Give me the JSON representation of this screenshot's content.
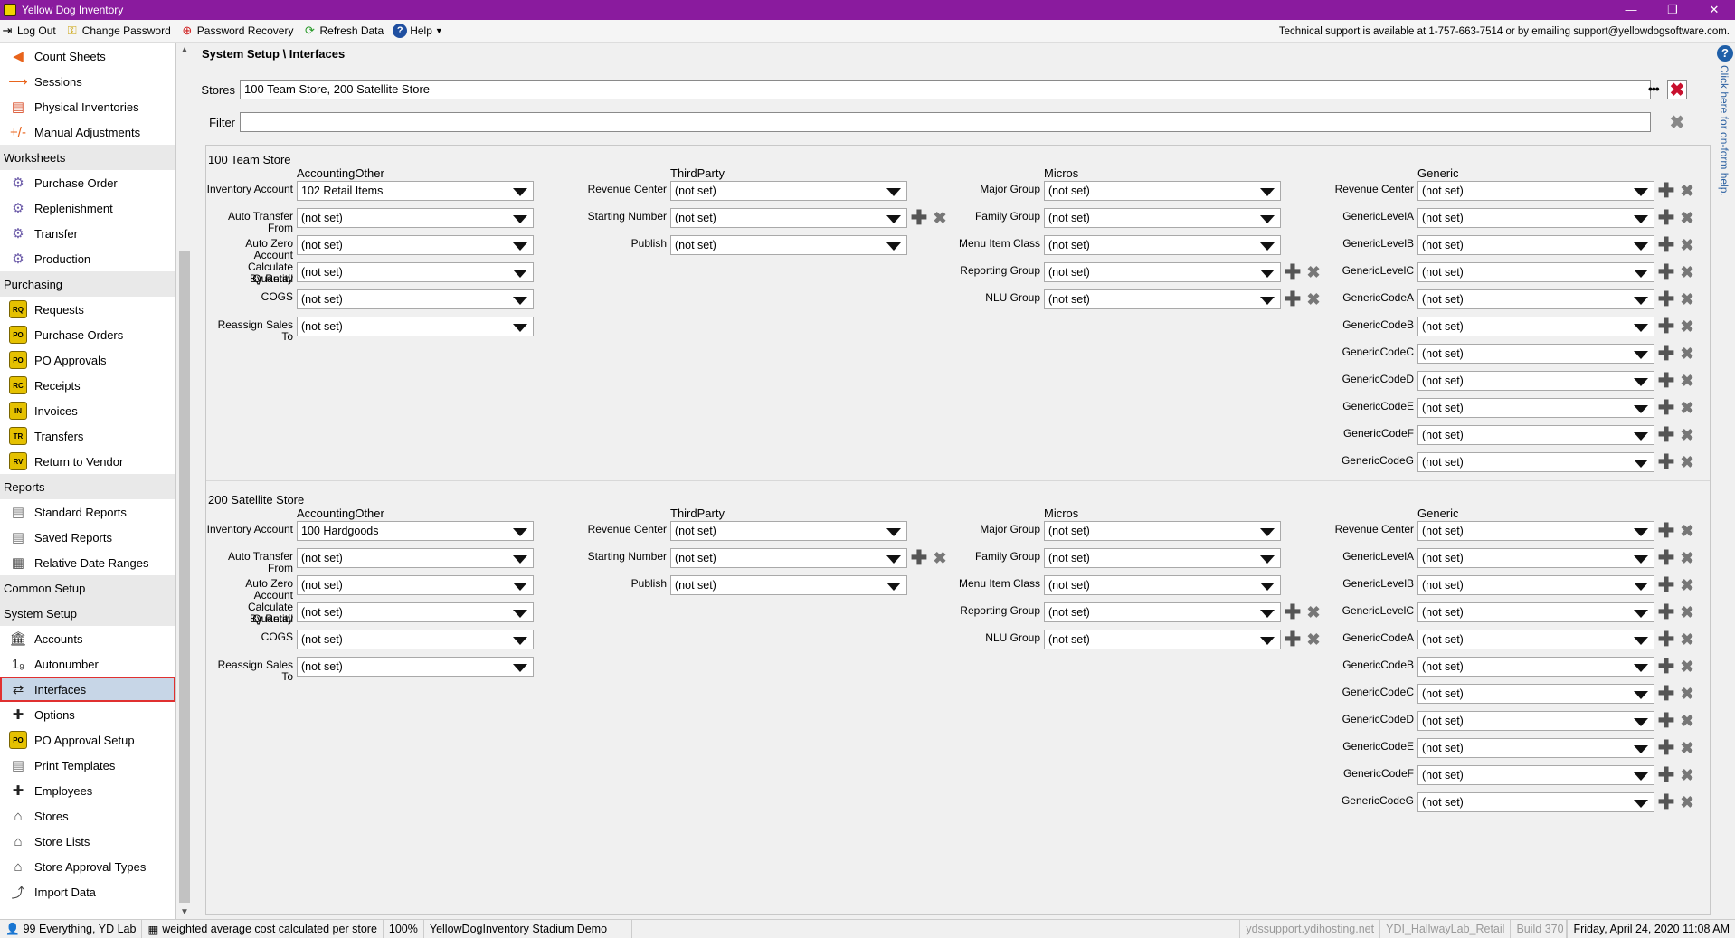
{
  "window": {
    "title": "Yellow Dog Inventory",
    "minimize": "—",
    "restore": "❐",
    "close": "✕"
  },
  "toolbar": {
    "logout": "Log Out",
    "change_password": "Change Password",
    "password_recovery": "Password Recovery",
    "refresh": "Refresh Data",
    "help": "Help"
  },
  "support_text": "Technical support is available at 1-757-663-7514 or by emailing support@yellowdogsoftware.com.",
  "sidebar": {
    "items": [
      {
        "label": "Count Sheets",
        "type": "item",
        "icon": "count-sheets-icon",
        "glyph": "◀",
        "color": "#e8641c"
      },
      {
        "label": "Sessions",
        "type": "item",
        "icon": "sessions-icon",
        "glyph": "⟶",
        "color": "#e8641c"
      },
      {
        "label": "Physical Inventories",
        "type": "item",
        "icon": "physical-inventories-icon",
        "glyph": "▤",
        "color": "#d9502c"
      },
      {
        "label": "Manual Adjustments",
        "type": "item",
        "icon": "manual-adjustments-icon",
        "glyph": "+/-",
        "color": "#e8641c"
      },
      {
        "label": "Worksheets",
        "type": "header"
      },
      {
        "label": "Purchase Order",
        "type": "item",
        "icon": "purchase-order-worksheet-icon",
        "glyph": "⚙",
        "color": "#6b5aa8"
      },
      {
        "label": "Replenishment",
        "type": "item",
        "icon": "replenishment-icon",
        "glyph": "⚙",
        "color": "#6b5aa8"
      },
      {
        "label": "Transfer",
        "type": "item",
        "icon": "transfer-worksheet-icon",
        "glyph": "⚙",
        "color": "#6b5aa8"
      },
      {
        "label": "Production",
        "type": "item",
        "icon": "production-icon",
        "glyph": "⚙",
        "color": "#6b5aa8"
      },
      {
        "label": "Purchasing",
        "type": "header"
      },
      {
        "label": "Requests",
        "type": "item",
        "icon": "requests-icon",
        "glyph": "RQ",
        "color": "#e5c100"
      },
      {
        "label": "Purchase Orders",
        "type": "item",
        "icon": "purchase-orders-icon",
        "glyph": "PO",
        "color": "#e5c100"
      },
      {
        "label": "PO Approvals",
        "type": "item",
        "icon": "po-approvals-icon",
        "glyph": "PO",
        "color": "#e5c100"
      },
      {
        "label": "Receipts",
        "type": "item",
        "icon": "receipts-icon",
        "glyph": "RC",
        "color": "#e5c100"
      },
      {
        "label": "Invoices",
        "type": "item",
        "icon": "invoices-icon",
        "glyph": "IN",
        "color": "#e5c100"
      },
      {
        "label": "Transfers",
        "type": "item",
        "icon": "transfers-icon",
        "glyph": "TR",
        "color": "#e5c100"
      },
      {
        "label": "Return to Vendor",
        "type": "item",
        "icon": "return-to-vendor-icon",
        "glyph": "RV",
        "color": "#e5c100"
      },
      {
        "label": "Reports",
        "type": "header"
      },
      {
        "label": "Standard Reports",
        "type": "item",
        "icon": "standard-reports-icon",
        "glyph": "▤",
        "color": "#777"
      },
      {
        "label": "Saved Reports",
        "type": "item",
        "icon": "saved-reports-icon",
        "glyph": "▤",
        "color": "#777"
      },
      {
        "label": "Relative Date Ranges",
        "type": "item",
        "icon": "calendar-icon",
        "glyph": "▦",
        "color": "#555"
      },
      {
        "label": "Common Setup",
        "type": "header"
      },
      {
        "label": "System Setup",
        "type": "header"
      },
      {
        "label": "Accounts",
        "type": "item",
        "icon": "bank-icon",
        "glyph": "🏛",
        "color": "#333"
      },
      {
        "label": "Autonumber",
        "type": "item",
        "icon": "autonumber-icon",
        "glyph": "1₉",
        "color": "#333"
      },
      {
        "label": "Interfaces",
        "type": "item",
        "icon": "interfaces-icon",
        "glyph": "⇄",
        "color": "#222",
        "selected": true
      },
      {
        "label": "Options",
        "type": "item",
        "icon": "options-plus-icon",
        "glyph": "✚",
        "color": "#222"
      },
      {
        "label": "PO Approval Setup",
        "type": "item",
        "icon": "po-approval-setup-icon",
        "glyph": "PO",
        "color": "#e5c100"
      },
      {
        "label": "Print Templates",
        "type": "item",
        "icon": "print-templates-icon",
        "glyph": "▤",
        "color": "#777"
      },
      {
        "label": "Employees",
        "type": "item",
        "icon": "employees-plus-icon",
        "glyph": "✚",
        "color": "#222"
      },
      {
        "label": "Stores",
        "type": "item",
        "icon": "stores-icon",
        "glyph": "⌂",
        "color": "#444"
      },
      {
        "label": "Store Lists",
        "type": "item",
        "icon": "store-lists-icon",
        "glyph": "⌂",
        "color": "#444"
      },
      {
        "label": "Store Approval Types",
        "type": "item",
        "icon": "store-approval-types-icon",
        "glyph": "⌂",
        "color": "#444"
      },
      {
        "label": "Import Data",
        "type": "item",
        "icon": "import-data-icon",
        "glyph": "⤴",
        "color": "#444"
      }
    ]
  },
  "breadcrumb": "System Setup \\ Interfaces",
  "stores_filter": {
    "label": "Stores",
    "value": "100 Team Store, 200 Satellite Store",
    "ellipsis": "•••"
  },
  "filter": {
    "label": "Filter",
    "value": ""
  },
  "sections": [
    {
      "title": "100 Team Store",
      "accounting": {
        "header": "AccountingOther",
        "fields": [
          {
            "label": "Inventory Account",
            "value": "102 Retail Items"
          },
          {
            "label": "Auto Transfer From",
            "value": "(not set)"
          },
          {
            "label": "Auto Zero Account",
            "value": "(not set)"
          },
          {
            "label": "Calculate Quantity By Retail COGS",
            "label1": "Calculate Quantity",
            "label2": "By Retail",
            "label3": "COGS",
            "value": "(not set)",
            "value2": "(not set)"
          },
          {
            "label": "Reassign Sales To",
            "value": "(not set)"
          }
        ]
      },
      "thirdparty": {
        "header": "ThirdParty",
        "fields": [
          {
            "label": "Revenue Center",
            "value": "(not set)"
          },
          {
            "label": "Starting Number",
            "value": "(not set)"
          },
          {
            "label": "Publish",
            "value": "(not set)"
          }
        ]
      },
      "micros": {
        "header": "Micros",
        "fields": [
          {
            "label": "Major Group",
            "value": "(not set)"
          },
          {
            "label": "Family Group",
            "value": "(not set)"
          },
          {
            "label": "Menu Item Class",
            "value": "(not set)"
          },
          {
            "label": "Reporting Group",
            "value": "(not set)"
          },
          {
            "label": "NLU Group",
            "value": "(not set)"
          }
        ]
      },
      "generic": {
        "header": "Generic",
        "fields": [
          {
            "label": "Revenue Center",
            "value": "(not set)"
          },
          {
            "label": "GenericLevelA",
            "value": "(not set)"
          },
          {
            "label": "GenericLevelB",
            "value": "(not set)"
          },
          {
            "label": "GenericLevelC",
            "value": "(not set)"
          },
          {
            "label": "GenericCodeA",
            "value": "(not set)"
          },
          {
            "label": "GenericCodeB",
            "value": "(not set)"
          },
          {
            "label": "GenericCodeC",
            "value": "(not set)"
          },
          {
            "label": "GenericCodeD",
            "value": "(not set)"
          },
          {
            "label": "GenericCodeE",
            "value": "(not set)"
          },
          {
            "label": "GenericCodeF",
            "value": "(not set)"
          },
          {
            "label": "GenericCodeG",
            "value": "(not set)"
          }
        ]
      }
    },
    {
      "title": "200 Satellite Store",
      "accounting": {
        "header": "AccountingOther",
        "fields": [
          {
            "label": "Inventory Account",
            "value": "100 Hardgoods"
          },
          {
            "label": "Auto Transfer From",
            "value": "(not set)"
          },
          {
            "label": "Auto Zero Account",
            "value": "(not set)"
          },
          {
            "label": "Calculate Quantity By Retail COGS",
            "label1": "Calculate Quantity",
            "label2": "By Retail",
            "label3": "COGS",
            "value": "(not set)",
            "value2": "(not set)"
          },
          {
            "label": "Reassign Sales To",
            "value": "(not set)"
          }
        ]
      },
      "thirdparty": {
        "header": "ThirdParty",
        "fields": [
          {
            "label": "Revenue Center",
            "value": "(not set)"
          },
          {
            "label": "Starting Number",
            "value": "(not set)"
          },
          {
            "label": "Publish",
            "value": "(not set)"
          }
        ]
      },
      "micros": {
        "header": "Micros",
        "fields": [
          {
            "label": "Major Group",
            "value": "(not set)"
          },
          {
            "label": "Family Group",
            "value": "(not set)"
          },
          {
            "label": "Menu Item Class",
            "value": "(not set)"
          },
          {
            "label": "Reporting Group",
            "value": "(not set)"
          },
          {
            "label": "NLU Group",
            "value": "(not set)"
          }
        ]
      },
      "generic": {
        "header": "Generic",
        "fields": [
          {
            "label": "Revenue Center",
            "value": "(not set)"
          },
          {
            "label": "GenericLevelA",
            "value": "(not set)"
          },
          {
            "label": "GenericLevelB",
            "value": "(not set)"
          },
          {
            "label": "GenericLevelC",
            "value": "(not set)"
          },
          {
            "label": "GenericCodeA",
            "value": "(not set)"
          },
          {
            "label": "GenericCodeB",
            "value": "(not set)"
          },
          {
            "label": "GenericCodeC",
            "value": "(not set)"
          },
          {
            "label": "GenericCodeD",
            "value": "(not set)"
          },
          {
            "label": "GenericCodeE",
            "value": "(not set)"
          },
          {
            "label": "GenericCodeF",
            "value": "(not set)"
          },
          {
            "label": "GenericCodeG",
            "value": "(not set)"
          }
        ]
      }
    }
  ],
  "help_strip": {
    "text": "Click here for on-form help."
  },
  "statusbar": {
    "user": "99 Everything, YD Lab",
    "costing": "weighted average cost calculated per store",
    "zoom": "100%",
    "database": "YellowDogInventory Stadium Demo",
    "host": "ydssupport.ydihosting.net",
    "db_name": "YDI_HallwayLab_Retail",
    "build": "Build 370",
    "date": "Friday, April 24, 2020 11:08 AM"
  },
  "colors": {
    "titlebar": "#8a1b9e",
    "selection": "#c7d6e7",
    "highlight_box": "#e03030",
    "remove_red": "#c8102e"
  }
}
